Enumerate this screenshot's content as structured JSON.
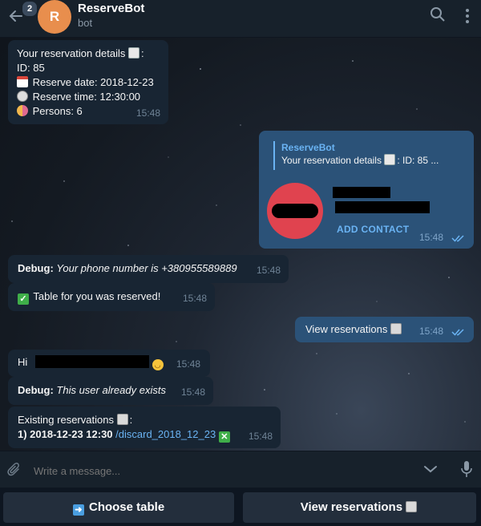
{
  "header": {
    "back_icon": "arrow-left-icon",
    "unread_badge": "2",
    "avatar_letter": "R",
    "avatar_color": "#e88e4d",
    "title": "ReserveBot",
    "subtitle": "bot",
    "search_icon": "search-icon",
    "more_icon": "more-vertical-icon"
  },
  "messages": [
    {
      "dir": "in",
      "lines": {
        "l1": "Your reservation details",
        "l1_tail": ":",
        "l2": "ID: 85",
        "l3": "Reserve date: 2018-12-23",
        "l4": "Reserve time: 12:30:00",
        "l5": "Persons: 6"
      },
      "time": "15:48"
    },
    {
      "dir": "out",
      "reply_name": "ReserveBot",
      "reply_text": "Your reservation details",
      "reply_tail": ": ID: 85 ...",
      "contact_action": "ADD CONTACT",
      "contact_avatar_color": "#e0434f",
      "time": "15:48"
    },
    {
      "dir": "in",
      "label": "Debug:",
      "text": "Your phone number is +380955589889",
      "time": "15:48"
    },
    {
      "dir": "in",
      "text": "Table for you was reserved!",
      "time": "15:48"
    },
    {
      "dir": "out",
      "text": "View reservations",
      "time": "15:48"
    },
    {
      "dir": "in",
      "text": "Hi",
      "time": "15:48"
    },
    {
      "dir": "in",
      "label": "Debug:",
      "text": "This user already exists",
      "time": "15:48"
    },
    {
      "dir": "in",
      "title": "Existing reservations",
      "title_tail": ":",
      "item": "1) 2018-12-23 12:30",
      "link": "/discard_2018_12_23",
      "time": "15:48"
    }
  ],
  "input": {
    "placeholder": "Write a message..."
  },
  "keyboard": {
    "button1": "Choose table",
    "button2": "View reservations"
  },
  "colors": {
    "incoming_bubble": "#182533",
    "outgoing_bubble": "#2b5278",
    "link": "#6ab3f3",
    "header_bg": "#17212b"
  }
}
